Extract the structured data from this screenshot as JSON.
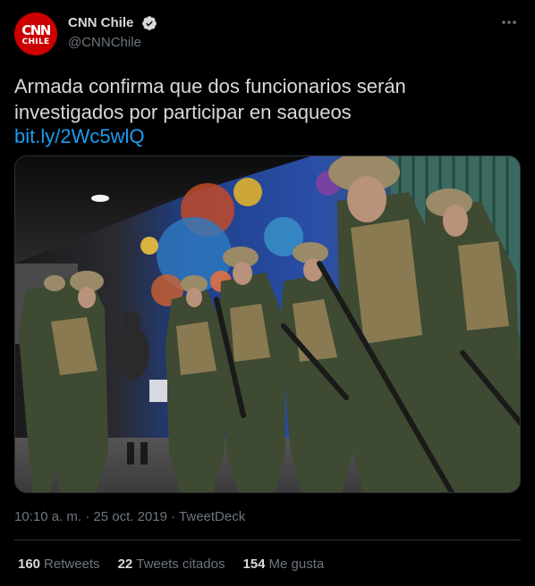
{
  "author": {
    "avatar_text": "CNN",
    "avatar_subtext": "CHILE",
    "display_name": "CNN Chile",
    "handle": "@CNNChile",
    "verified": true,
    "avatar_icon": "cnn-chile-logo"
  },
  "tweet": {
    "text": "Armada confirma que dos funcionarios serán investigados por participar en saqueos",
    "link": "bit.ly/2Wc5wlQ",
    "media_description_icon": "photo-soldiers"
  },
  "meta": {
    "time": "10:10 a. m.",
    "separator1": " · ",
    "date": "25 oct. 2019",
    "separator2": " · ",
    "source": "TweetDeck"
  },
  "stats": {
    "retweets_count": "160",
    "retweets_label": "Retweets",
    "quotes_count": "22",
    "quotes_label": "Tweets citados",
    "likes_count": "154",
    "likes_label": "Me gusta"
  },
  "colors": {
    "background": "#000000",
    "text": "#d9d9d9",
    "secondary": "#6e767d",
    "link": "#1d9bf0",
    "brand_red": "#cc0000"
  }
}
